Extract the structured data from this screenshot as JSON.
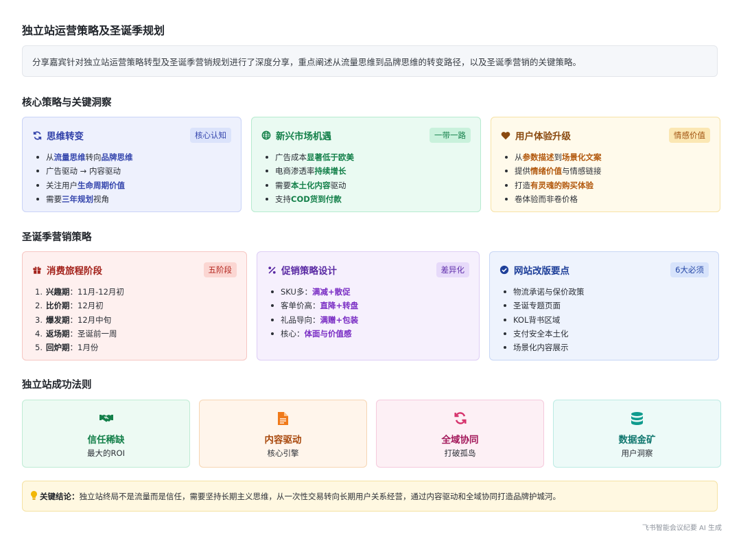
{
  "title": "独立站运营策略及圣诞季规划",
  "summary": "分享嘉宾针对独立站运营策略转型及圣诞季营销规划进行了深度分享，重点阐述从流量思维到品牌思维的转变路径，以及圣诞季营销的关键策略。",
  "section1": {
    "heading": "核心策略与关键洞察",
    "cards": [
      {
        "icon": "refresh-icon",
        "title": "思维转变",
        "tag": "核心认知",
        "items": [
          [
            {
              "t": "从"
            },
            {
              "t": "流量思维",
              "h": true
            },
            {
              "t": "转向"
            },
            {
              "t": "品牌思维",
              "h": true
            }
          ],
          [
            {
              "t": "广告驱动 → 内容驱动"
            }
          ],
          [
            {
              "t": "关注用户"
            },
            {
              "t": "生命周期价值",
              "h": true
            }
          ],
          [
            {
              "t": "需要"
            },
            {
              "t": "三年规划",
              "h": true
            },
            {
              "t": "视角"
            }
          ]
        ]
      },
      {
        "icon": "globe-icon",
        "title": "新兴市场机遇",
        "tag": "一带一路",
        "items": [
          [
            {
              "t": "广告成本"
            },
            {
              "t": "显著低于欧美",
              "h": true
            }
          ],
          [
            {
              "t": "电商渗透率"
            },
            {
              "t": "持续增长",
              "h": true
            }
          ],
          [
            {
              "t": "需要"
            },
            {
              "t": "本土化内容",
              "h": true
            },
            {
              "t": "驱动"
            }
          ],
          [
            {
              "t": "支持"
            },
            {
              "t": "COD货到付款",
              "h": true
            }
          ]
        ]
      },
      {
        "icon": "heart-icon",
        "title": "用户体验升级",
        "tag": "情感价值",
        "items": [
          [
            {
              "t": "从"
            },
            {
              "t": "参数描述",
              "h": true
            },
            {
              "t": "到"
            },
            {
              "t": "场景化文案",
              "h": true
            }
          ],
          [
            {
              "t": "提供"
            },
            {
              "t": "情绪价值",
              "h": true
            },
            {
              "t": "与情感链接"
            }
          ],
          [
            {
              "t": "打造"
            },
            {
              "t": "有灵魂的购买体验",
              "h": true
            }
          ],
          [
            {
              "t": "卷体验而非卷价格"
            }
          ]
        ]
      }
    ]
  },
  "section2": {
    "heading": "圣诞季营销策略",
    "cards": [
      {
        "icon": "gift-icon",
        "title": "消费旅程阶段",
        "tag": "五阶段",
        "ordered": true,
        "items": [
          [
            {
              "t": "兴趣期",
              "h": true
            },
            {
              "t": "：11月-12月初"
            }
          ],
          [
            {
              "t": "比价期",
              "h": true
            },
            {
              "t": "：12月初"
            }
          ],
          [
            {
              "t": "爆发期",
              "h": true
            },
            {
              "t": "：12月中旬"
            }
          ],
          [
            {
              "t": "返场期",
              "h": true
            },
            {
              "t": "：圣诞前一周"
            }
          ],
          [
            {
              "t": "回炉期",
              "h": true
            },
            {
              "t": "：1月份"
            }
          ]
        ]
      },
      {
        "icon": "percent-icon",
        "title": "促销策略设计",
        "tag": "差异化",
        "items": [
          [
            {
              "t": "SKU多："
            },
            {
              "t": "满减+散促",
              "h": true
            }
          ],
          [
            {
              "t": "客单价高："
            },
            {
              "t": "直降+转盘",
              "h": true
            }
          ],
          [
            {
              "t": "礼品导向："
            },
            {
              "t": "满赠+包装",
              "h": true
            }
          ],
          [
            {
              "t": "核心："
            },
            {
              "t": "体面与价值感",
              "h": true
            }
          ]
        ]
      },
      {
        "icon": "check-circle-icon",
        "title": "网站改版要点",
        "tag": "6大必须",
        "items": [
          [
            {
              "t": "物流承诺与保价政策"
            }
          ],
          [
            {
              "t": "圣诞专题页面"
            }
          ],
          [
            {
              "t": "KOL背书区域"
            }
          ],
          [
            {
              "t": "支付安全本土化"
            }
          ],
          [
            {
              "t": "场景化内容展示"
            }
          ]
        ]
      }
    ]
  },
  "section3": {
    "heading": "独立站成功法则",
    "items": [
      {
        "icon": "handshake-icon",
        "title": "信任稀缺",
        "sub": "最大的ROI"
      },
      {
        "icon": "document-icon",
        "title": "内容驱动",
        "sub": "核心引擎"
      },
      {
        "icon": "sync-icon",
        "title": "全域协同",
        "sub": "打破孤岛"
      },
      {
        "icon": "database-icon",
        "title": "数据金矿",
        "sub": "用户洞察"
      }
    ]
  },
  "conclusion": {
    "icon": "lightbulb-icon",
    "label": "关键结论：",
    "text": "独立站终局不是流量而是信任，需要坚持长期主义思维，从一次性交易转向长期用户关系经营，通过内容驱动和全域协同打造品牌护城河。"
  },
  "footer": "飞书智能会议纪要 AI 生成",
  "colors": {
    "blue": "#3546ad",
    "green": "#14804a",
    "amber": "#b2590e",
    "red": "#b3261e",
    "purple": "#7a2ec4",
    "sky": "#2547a6",
    "pink": "#d6336c",
    "teal": "#0f766e"
  }
}
